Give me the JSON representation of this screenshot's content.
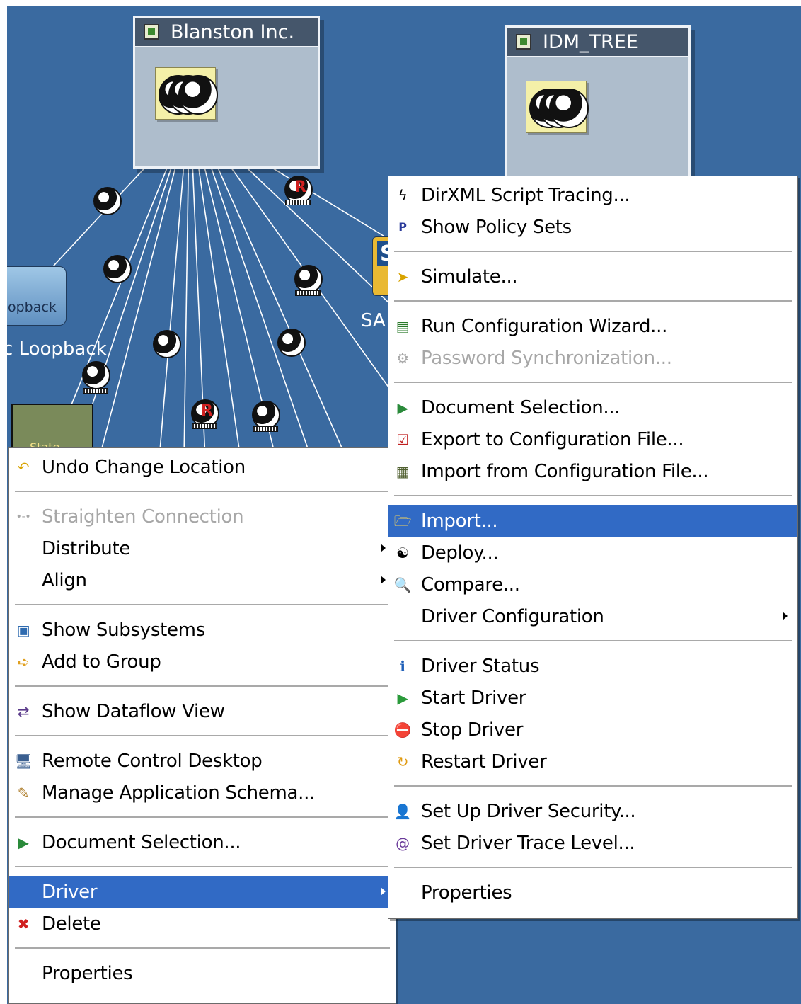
{
  "canvas": {
    "vault_left": {
      "title": "Blanston Inc."
    },
    "vault_right": {
      "title": "IDM_TREE"
    },
    "labels": {
      "loopback_tile": "opback",
      "loopback_caption": "c Loopback",
      "sap_tile": "S",
      "sap_caption": "SA",
      "state_tile": "State",
      "r_mark": "R"
    }
  },
  "left_menu": {
    "undo": "Undo Change Location",
    "straighten": "Straighten Connection",
    "distribute": "Distribute",
    "align": "Align",
    "show_subsystems": "Show Subsystems",
    "add_to_group": "Add to Group",
    "show_dataflow": "Show Dataflow View",
    "remote_control": "Remote Control Desktop",
    "manage_schema": "Manage Application Schema...",
    "document_selection": "Document Selection...",
    "driver": "Driver",
    "delete": "Delete",
    "properties": "Properties"
  },
  "right_menu": {
    "script_tracing": "DirXML Script Tracing...",
    "show_policy_sets": "Show Policy Sets",
    "simulate": "Simulate...",
    "run_config_wizard": "Run Configuration Wizard...",
    "password_sync": "Password Synchronization...",
    "document_selection": "Document Selection...",
    "export_config": "Export to Configuration File...",
    "import_config": "Import from Configuration File...",
    "import": "Import...",
    "deploy": "Deploy...",
    "compare": "Compare...",
    "driver_configuration": "Driver Configuration",
    "driver_status": "Driver Status",
    "start_driver": "Start Driver",
    "stop_driver": "Stop Driver",
    "restart_driver": "Restart Driver",
    "set_up_security": "Set Up Driver Security...",
    "set_trace_level": "Set Driver Trace Level...",
    "properties": "Properties"
  },
  "colors": {
    "canvas_bg": "#3a6aa0",
    "highlight": "#316ac5",
    "vault_title": "#45566b"
  }
}
